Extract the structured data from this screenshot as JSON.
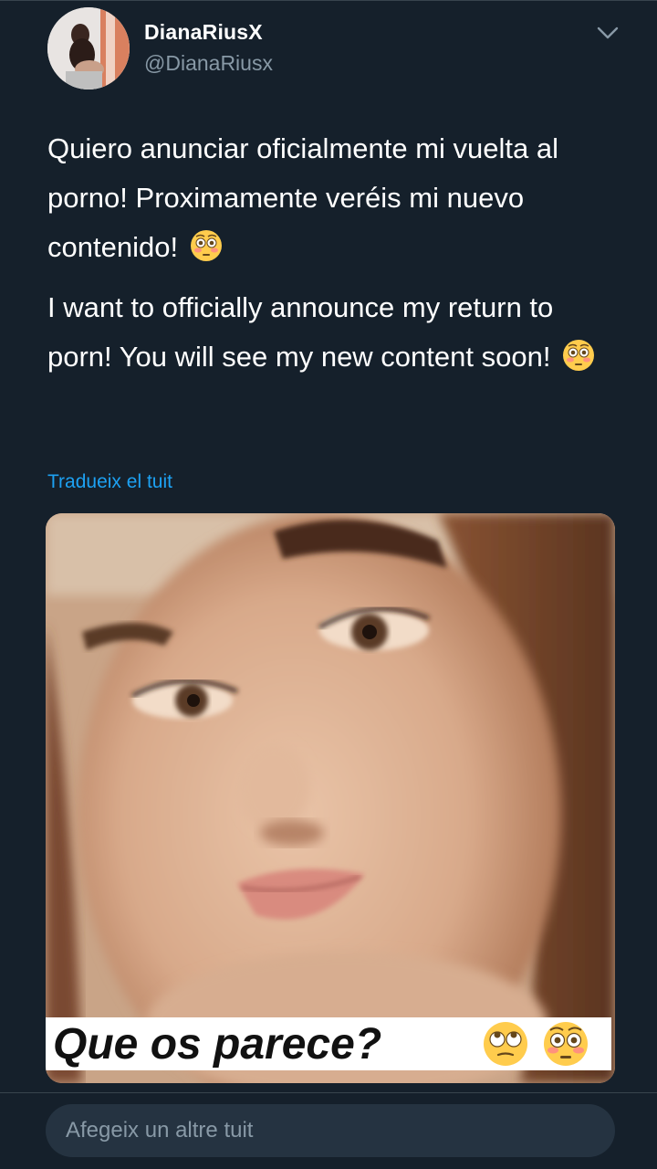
{
  "tweet": {
    "display_name": "DianaRiusX",
    "handle": "@DianaRiusx",
    "text_es": "Quiero anunciar oficialmente mi vuelta al porno! Proximamente veréis mi nuevo contenido!",
    "text_en": "I want to officially announce my return to porn!  You will see my new content soon!",
    "translate_label": "Tradueix el tuit",
    "media_caption": "Que os parece?"
  },
  "reply": {
    "placeholder": "Afegeix un altre tuit"
  },
  "icons": {
    "more": "chevron-down-icon",
    "emoji_flushed": "flushed-face-emoji",
    "emoji_rolling_eyes": "rolling-eyes-emoji"
  },
  "colors": {
    "background": "#15202b",
    "link": "#1da1f2",
    "secondary_text": "#8899a6",
    "reply_box": "#253341"
  }
}
